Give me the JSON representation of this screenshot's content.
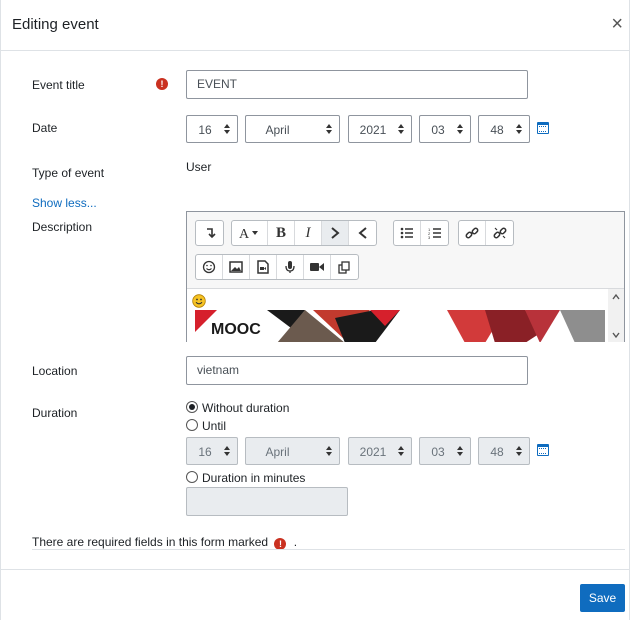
{
  "modal": {
    "title": "Editing event",
    "close_glyph": "×"
  },
  "form": {
    "event_title": {
      "label": "Event title",
      "value": "EVENT",
      "required_glyph": "!"
    },
    "date": {
      "label": "Date",
      "day": "16",
      "month": "April",
      "year": "2021",
      "hour": "03",
      "minute": "48",
      "calendar_icon": "calendar-icon"
    },
    "type_of_event": {
      "label": "Type of event",
      "value": "User"
    },
    "show_less": "Show less...",
    "description": {
      "label": "Description",
      "toolbar_row1": [
        [
          {
            "icon": "collapse-icon"
          }
        ],
        [
          {
            "icon": "font-color-icon"
          },
          {
            "text": "B",
            "icon": "bold-icon"
          },
          {
            "text": "I",
            "icon": "italic-icon"
          },
          {
            "icon": "ltr-icon"
          },
          {
            "icon": "rtl-icon"
          }
        ],
        [
          {
            "icon": "unordered-list-icon"
          },
          {
            "icon": "ordered-list-icon"
          }
        ],
        [
          {
            "icon": "link-icon"
          },
          {
            "icon": "unlink-icon"
          }
        ]
      ],
      "toolbar_row2": [
        [
          {
            "icon": "emoji-icon"
          },
          {
            "icon": "image-icon"
          },
          {
            "icon": "media-icon"
          },
          {
            "icon": "record-audio-icon"
          },
          {
            "icon": "record-video-icon"
          },
          {
            "icon": "manage-files-icon"
          }
        ]
      ],
      "content_banner_text": "MOOC",
      "content_emoji": "smiley-emoji"
    },
    "location": {
      "label": "Location",
      "value": "vietnam"
    },
    "duration": {
      "label": "Duration",
      "options": [
        "Without duration",
        "Until",
        "Duration in minutes"
      ],
      "selected": "Without duration",
      "until": {
        "day": "16",
        "month": "April",
        "year": "2021",
        "hour": "03",
        "minute": "48"
      },
      "minutes_value": ""
    },
    "required_note": "There are required fields in this form marked",
    "required_note_suffix": "."
  },
  "footer": {
    "save_label": "Save"
  },
  "colors": {
    "primary": "#0f6cbf",
    "required": "#ca3120"
  }
}
